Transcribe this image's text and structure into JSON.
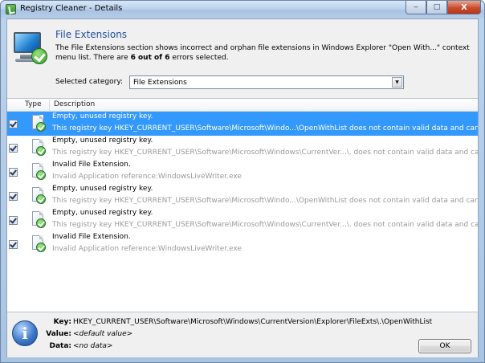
{
  "window": {
    "title": "Registry Cleaner - Details",
    "controls": {
      "minimize": "‒",
      "maximize": "□",
      "close": "X"
    }
  },
  "header": {
    "title": "File Extensions",
    "description_prefix": "The File Extensions section shows incorrect and orphan file extensions in Windows Explorer \"Open With...\" context menu list. There are ",
    "selected_count": "6 out of 6",
    "description_suffix": " errors selected."
  },
  "category": {
    "label": "Selected category:",
    "value": "File Extensions"
  },
  "list": {
    "columns": [
      "Type",
      "Description"
    ],
    "rows": [
      {
        "title": "Empty, unused registry key.",
        "detail": "This registry key HKEY_CURRENT_USER\\Software\\Microsoft\\Windo...\\OpenWithList does not contain valid data and can be removed.",
        "checked": true,
        "selected": true
      },
      {
        "title": "Empty, unused registry key.",
        "detail": "This registry key HKEY_CURRENT_USER\\Software\\Microsoft\\Windows\\CurrentVer...\\. does not contain valid data and can be removed.",
        "checked": true,
        "selected": false
      },
      {
        "title": "Invalid File Extension.",
        "detail": "Invalid Application reference:WindowsLiveWriter.exe",
        "checked": true,
        "selected": false
      },
      {
        "title": "Empty, unused registry key.",
        "detail": "This registry key HKEY_CURRENT_USER\\Software\\Microsoft\\Windo...\\OpenWithList does not contain valid data and can be removed.",
        "checked": true,
        "selected": false
      },
      {
        "title": "Empty, unused registry key.",
        "detail": "This registry key HKEY_CURRENT_USER\\Software\\Microsoft\\Windows\\CurrentVer...\\. does not contain valid data and can be removed.",
        "checked": true,
        "selected": false
      },
      {
        "title": "Invalid File Extension.",
        "detail": "Invalid Application reference:WindowsLiveWriter.exe",
        "checked": true,
        "selected": false
      }
    ]
  },
  "details": {
    "key_label": "Key:",
    "key_value": "HKEY_CURRENT_USER\\Software\\Microsoft\\Windows\\CurrentVersion\\Explorer\\FileExts\\.\\OpenWithList",
    "value_label": "Value:",
    "value_value": "<default value>",
    "data_label": "Data:",
    "data_value": "<no data>",
    "info_glyph": "i"
  },
  "buttons": {
    "ok": "OK"
  },
  "colors": {
    "selection": "#3399ff",
    "title_blue": "#1e4fa0",
    "detail_gray": "#9a9a9a"
  }
}
